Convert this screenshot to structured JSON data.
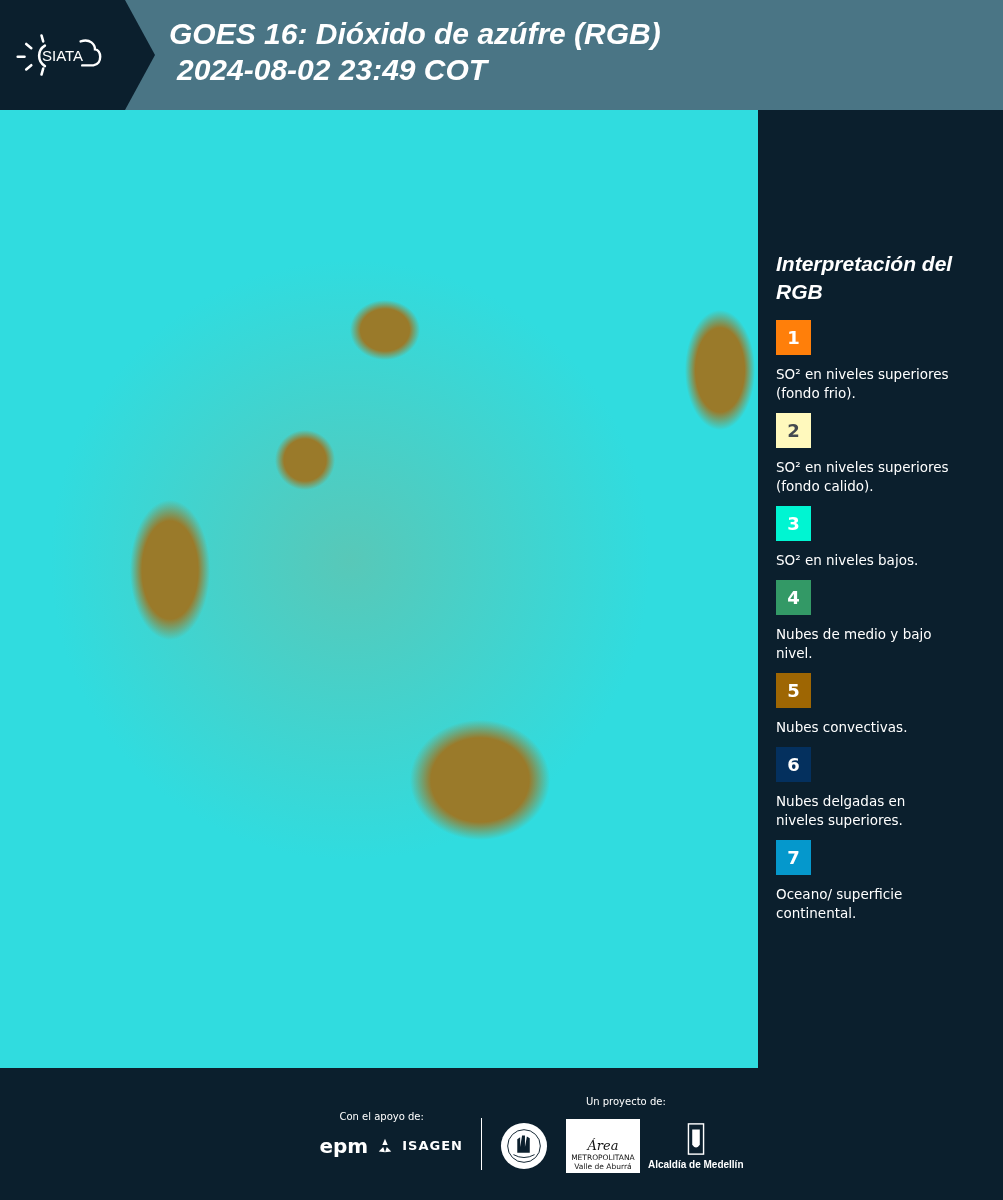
{
  "header": {
    "logo_text": "SIATA",
    "title": "GOES 16: Dióxido de azúfre (RGB)",
    "timestamp": "2024-08-02 23:49 COT"
  },
  "legend": {
    "title": "Interpretación del RGB",
    "items": [
      {
        "number": "1",
        "color": "#ff7f0a",
        "description": "SO² en niveles superiores (fondo frio)."
      },
      {
        "number": "2",
        "color": "#fff9bd",
        "description": "SO² en niveles superiores (fondo calido)."
      },
      {
        "number": "3",
        "color": "#00f5d2",
        "description": "SO² en niveles bajos."
      },
      {
        "number": "4",
        "color": "#339966",
        "description": "Nubes de medio y bajo nivel."
      },
      {
        "number": "5",
        "color": "#9e6603",
        "description": "Nubes convectivas."
      },
      {
        "number": "6",
        "color": "#04305e",
        "description": "Nubes delgadas en niveles superiores."
      },
      {
        "number": "7",
        "color": "#0598cc",
        "description": "Oceano/ superficie continental."
      }
    ]
  },
  "footer": {
    "support_label": "Con el apoyo de:",
    "project_label": "Un proyecto de:",
    "epm_logo": "epm",
    "isagen_logo": "ISAGEN",
    "area_logo": {
      "script": "Área",
      "line1": "METROPOLITANA",
      "line2": "Valle de Aburrá"
    },
    "alcaldia_logo": "Alcaldía de Medellín"
  }
}
